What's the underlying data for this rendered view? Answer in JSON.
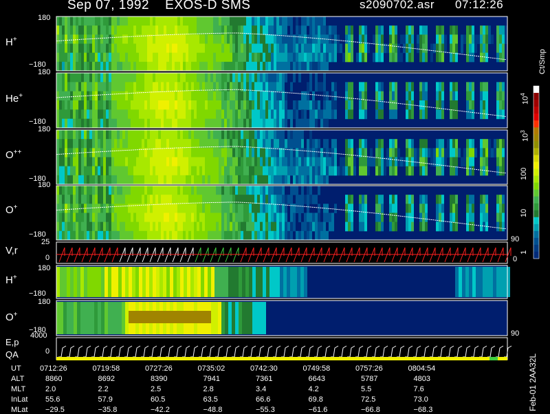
{
  "header": {
    "title": "Sep 07, 1992    EXOS-D SMS",
    "file": "s2090702.asr",
    "time": "07:12:26"
  },
  "panels": [
    {
      "species": "H",
      "charge": "+",
      "ymax": "180",
      "ymin": "−180"
    },
    {
      "species": "He",
      "charge": "+",
      "ymax": "180",
      "ymin": "−180"
    },
    {
      "species": "O",
      "charge": "++",
      "ymax": "180",
      "ymin": "−180"
    },
    {
      "species": "O",
      "charge": "+",
      "ymax": "180",
      "ymin": "−180"
    }
  ],
  "vr_panel": {
    "label": "V,r",
    "ymax": "25",
    "ymid": "0",
    "right_tick": "90",
    "right_zero": "0"
  },
  "h_low_panel": {
    "species": "H",
    "charge": "+",
    "ymax": "180",
    "ymin": "−180"
  },
  "o_low_panel": {
    "species": "O",
    "charge": "+",
    "ymax": "180",
    "ymin": "−180",
    "right_tick": "90"
  },
  "ep_panel": {
    "label1": "E,p",
    "label2": "QA",
    "ymax": "4000",
    "ymid": "0"
  },
  "colorbar": {
    "unit": "Ct/Smp",
    "labels": [
      {
        "text": "10",
        "exp": "4"
      },
      {
        "text": "10",
        "exp": "3"
      },
      {
        "text": "100",
        "exp": ""
      },
      {
        "text": "10",
        "exp": ""
      },
      {
        "text": "1",
        "exp": ""
      }
    ],
    "colors": [
      "#ffffff",
      "#8b0000",
      "#a00000",
      "#c00000",
      "#e00000",
      "#ff3000",
      "#b07a00",
      "#a08400",
      "#908e00",
      "#b0b000",
      "#d8d800",
      "#f0f000",
      "#d0f000",
      "#a8e800",
      "#80d800",
      "#60c830",
      "#40b050",
      "#2f9a3a",
      "#227a30",
      "#00c8c8",
      "#00a0b0",
      "#0070a0",
      "#005090",
      "#003a80",
      "#002a78"
    ]
  },
  "footer": {
    "rows": [
      {
        "label": "UT",
        "values": [
          "0712:26",
          "0719:58",
          "0727:26",
          "0735:02",
          "0742:30",
          "0749:58",
          "0757:26",
          "0804:54"
        ]
      },
      {
        "label": "ALT",
        "values": [
          "8860",
          "8692",
          "8390",
          "7941",
          "7361",
          "6643",
          "5787",
          "4803"
        ]
      },
      {
        "label": "MLT",
        "values": [
          "2.0",
          "2.2",
          "2.5",
          "2.8",
          "3.4",
          "4.2",
          "5.5",
          "7.6"
        ]
      },
      {
        "label": "InLat",
        "values": [
          "55.6",
          "57.9",
          "60.5",
          "63.5",
          "66.6",
          "69.8",
          "72.5",
          "73.0"
        ]
      },
      {
        "label": "MLat",
        "values": [
          "−29.5",
          "−35.8",
          "−42.2",
          "−48.8",
          "−55.3",
          "−61.6",
          "−66.8",
          "−68.3"
        ]
      }
    ],
    "side_text": "Feb-01 2AA32L"
  },
  "colors": {
    "background": "#000000",
    "plot_bg": "#001e6e",
    "frame": "#ffffff",
    "trace": "#ff2020"
  }
}
